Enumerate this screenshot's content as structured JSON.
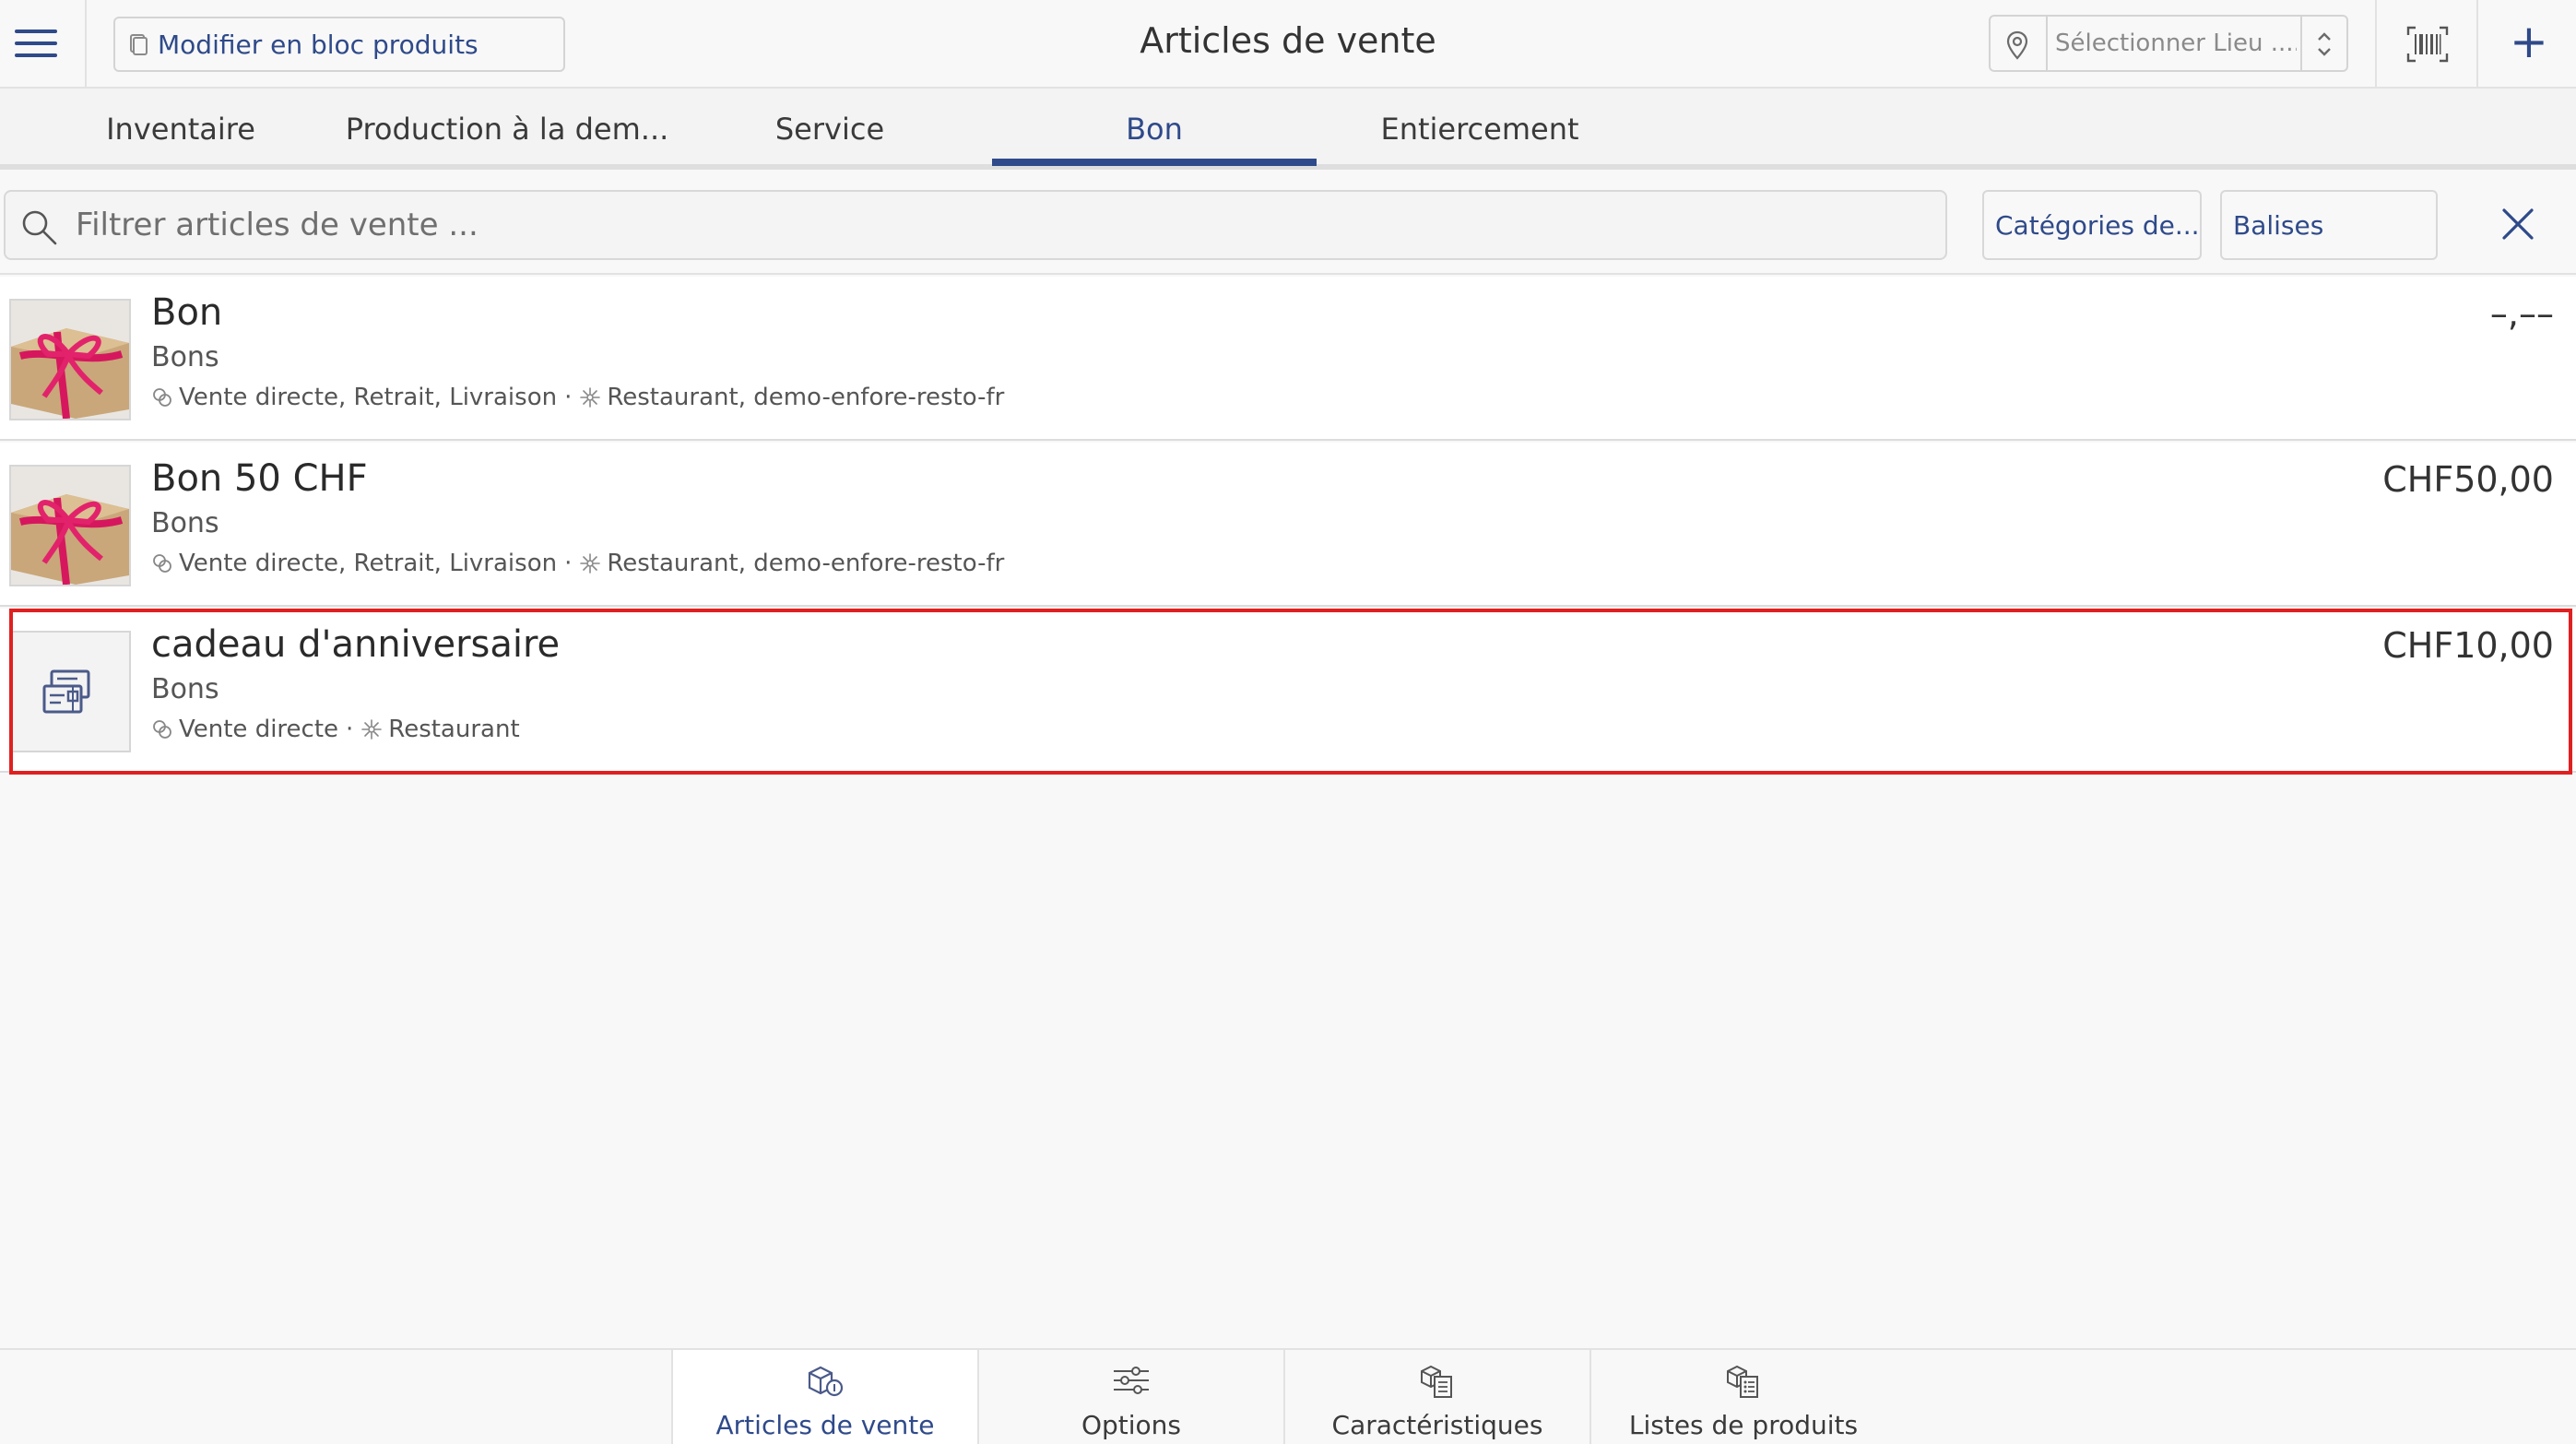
{
  "header": {
    "bulk_edit_label": "Modifier en bloc produits",
    "title": "Articles de vente",
    "location_placeholder": "Sélectionner Lieu ......",
    "plus_label": "+"
  },
  "tabs": [
    {
      "label": "Inventaire",
      "active": false
    },
    {
      "label": "Production à la dem...",
      "active": false
    },
    {
      "label": "Service",
      "active": false
    },
    {
      "label": "Bon",
      "active": true
    },
    {
      "label": "Entiercement",
      "active": false
    }
  ],
  "filter": {
    "search_placeholder": "Filtrer articles de vente ...",
    "categories_label": "Catégories de...",
    "tags_label": "Balises"
  },
  "items": [
    {
      "title": "Bon",
      "category": "Bons",
      "channels": "Vente directe, Retrait, Livraison",
      "locations": "Restaurant, demo-enfore-resto-fr",
      "price": "–,––",
      "thumbnail": "gift-photo"
    },
    {
      "title": "Bon 50 CHF",
      "category": "Bons",
      "channels": "Vente directe, Retrait, Livraison",
      "locations": "Restaurant, demo-enfore-resto-fr",
      "price": "CHF50,00",
      "thumbnail": "gift-photo"
    },
    {
      "title": "cadeau d'anniversaire",
      "category": "Bons",
      "channels": "Vente directe",
      "locations": "Restaurant",
      "price": "CHF10,00",
      "thumbnail": "voucher-icon"
    }
  ],
  "bottom_nav": [
    {
      "label": "Articles de vente",
      "icon": "sales-items-icon",
      "active": true
    },
    {
      "label": "Options",
      "icon": "sliders-icon",
      "active": false
    },
    {
      "label": "Caractéristiques",
      "icon": "features-icon",
      "active": false
    },
    {
      "label": "Listes de produits",
      "icon": "product-lists-icon",
      "active": false
    }
  ],
  "colors": {
    "accent": "#2f4a8a",
    "highlight": "#e02020"
  }
}
